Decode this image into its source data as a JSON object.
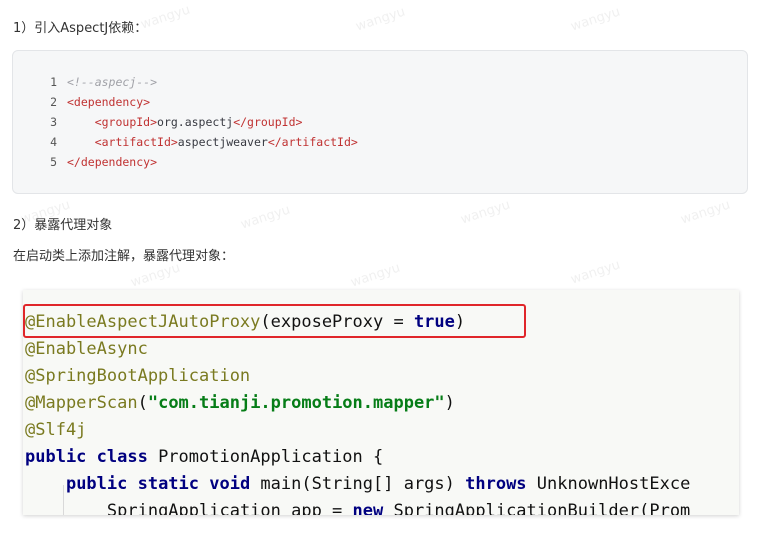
{
  "section1": {
    "heading": "1）引入AspectJ依赖："
  },
  "code1": {
    "lines": [
      {
        "num": "1",
        "text": "<!--aspecj-->"
      },
      {
        "num": "2",
        "text": "<dependency>"
      },
      {
        "num": "3",
        "open": "<groupId>",
        "value": "org.aspectj",
        "close": "</groupId>"
      },
      {
        "num": "4",
        "open": "<artifactId>",
        "value": "aspectjweaver",
        "close": "</artifactId>"
      },
      {
        "num": "5",
        "text": "</dependency>"
      }
    ]
  },
  "section2": {
    "heading": "2）暴露代理对象",
    "description": "在启动类上添加注解，暴露代理对象："
  },
  "code2": {
    "line1": {
      "annotation": "@EnableAspectJAutoProxy",
      "args_open": "(exposeProxy = ",
      "keyword": "true",
      "args_close": ")"
    },
    "line2": "@EnableAsync",
    "line3": "@SpringBootApplication",
    "line4": {
      "annotation": "@MapperScan",
      "open": "(",
      "string": "\"com.tianji.promotion.mapper\"",
      "close": ")"
    },
    "line5": "@Slf4j",
    "line6": {
      "kw": "public class",
      "rest": " PromotionApplication {"
    },
    "line7": {
      "indent": "    ",
      "kw": "public static void",
      "mid": " main(String[] args) ",
      "kw2": "throws",
      "rest": " UnknownHostExce"
    },
    "line8": {
      "indent": "        ",
      "a": "SpringApplication app = ",
      "kw": "new",
      "b": " SpringApplicationBuilder(Prom"
    }
  },
  "watermark": {
    "text": "wangyu"
  }
}
